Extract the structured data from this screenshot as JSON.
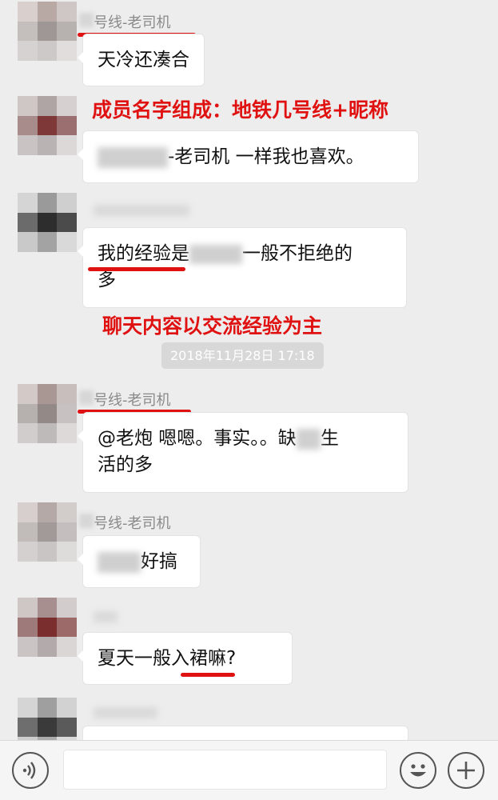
{
  "messages": [
    {
      "sender": "号线-老司机",
      "text": "天冷还凑合"
    },
    {
      "text_suffix": "-老司机 一样我也喜欢。"
    },
    {
      "text_prefix": "我的经验是",
      "text_suffix": "一般不拒绝的",
      "text_line2": "多"
    },
    {
      "sender": "号线-老司机",
      "text_line1": "@老炮 嗯嗯。事实。。缺",
      "text_line1_end": "生",
      "text_line2": "活的多"
    },
    {
      "sender": "号线-老司机",
      "text_suffix": "好搞"
    },
    {
      "text": "夏天一般入裙嘛?"
    }
  ],
  "annotations": {
    "member_names": "成员名字组成：地铁几号线+昵称",
    "chat_content": "聊天内容以交流经验为主"
  },
  "timestamp": "2018年11月28日 17:18",
  "input_bar": {
    "voice_icon": "voice-icon",
    "emoji_icon": "emoji-icon",
    "plus_icon": "plus-icon"
  },
  "colors": {
    "annotation_red": "#e01111",
    "background": "#ededed",
    "bubble": "#ffffff"
  }
}
